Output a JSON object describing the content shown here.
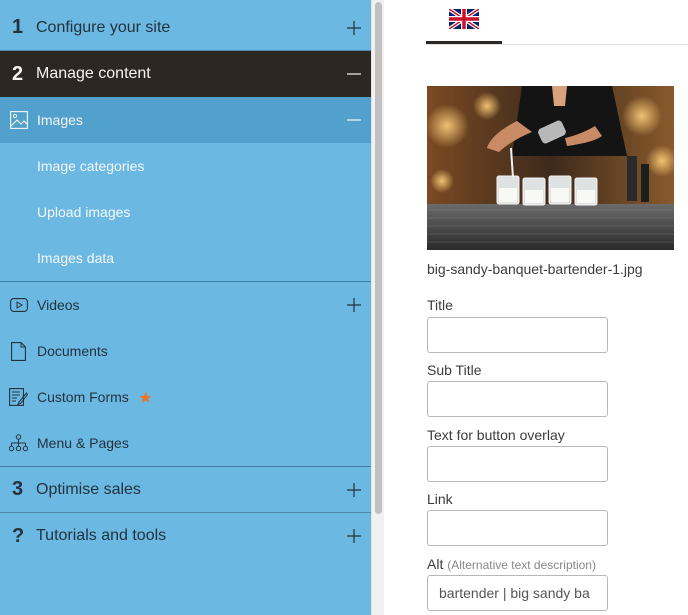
{
  "sidebar": {
    "sections": [
      {
        "num": "1",
        "label": "Configure your site",
        "toggle": "plus"
      },
      {
        "num": "2",
        "label": "Manage content",
        "toggle": "minus"
      },
      {
        "num": "3",
        "label": "Optimise sales",
        "toggle": "plus"
      },
      {
        "num": "?",
        "label": "Tutorials and tools",
        "toggle": "plus"
      }
    ],
    "images": {
      "label": "Images",
      "toggle": "minus",
      "icon": "image-icon"
    },
    "image_subitems": [
      "Image categories",
      "Upload images",
      "Images data"
    ],
    "items": [
      {
        "label": "Videos",
        "icon": "video-icon",
        "toggle": "plus"
      },
      {
        "label": "Documents",
        "icon": "document-icon"
      },
      {
        "label": "Custom Forms",
        "icon": "form-icon",
        "badge": "star-icon"
      },
      {
        "label": "Menu & Pages",
        "icon": "sitemap-icon"
      }
    ]
  },
  "editor": {
    "language_tab": "uk-flag-icon",
    "image_filename": "big-sandy-banquet-bartender-1.jpg",
    "fields": [
      {
        "label": "Title",
        "value": ""
      },
      {
        "label": "Sub Title",
        "value": ""
      },
      {
        "label": "Text for button overlay",
        "value": ""
      },
      {
        "label": "Link",
        "value": ""
      },
      {
        "label": "Alt",
        "hint": "(Alternative text description)",
        "value": "bartender | big sandy ba"
      }
    ]
  },
  "colors": {
    "sidebar_bg": "#6bb8e3",
    "active_section_bg": "#2d2723",
    "active_subitem_bg": "#52a1cc",
    "star": "#e8762d"
  }
}
